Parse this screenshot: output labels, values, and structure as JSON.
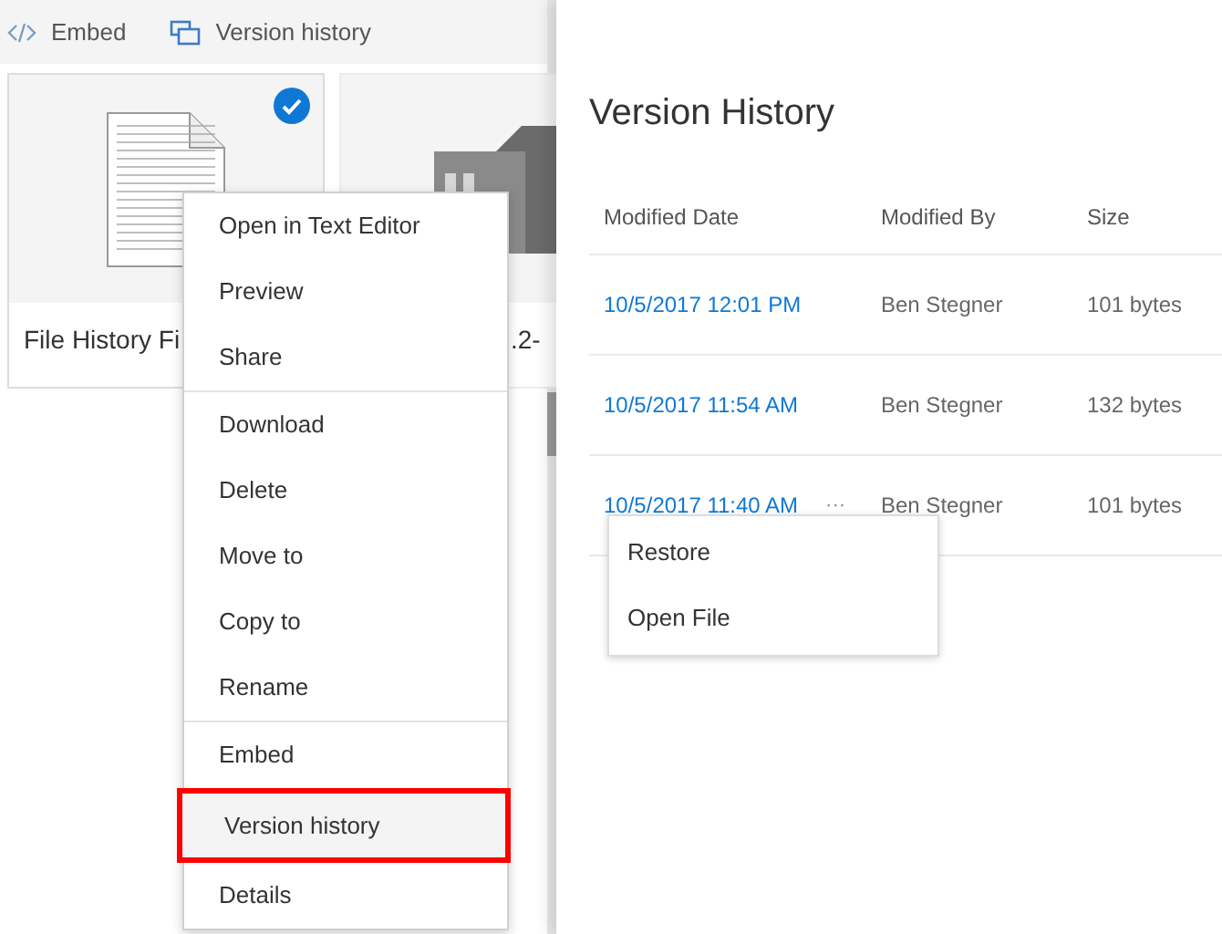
{
  "toolbar": [
    {
      "kind": "embed",
      "label": "Embed"
    },
    {
      "kind": "history",
      "label": "Version history"
    }
  ],
  "tiles": [
    {
      "kind": "text",
      "name": "File History Fi",
      "selected": true
    },
    {
      "kind": "archive",
      "name": ".2-",
      "selected": false
    }
  ],
  "context_menu": {
    "groups": [
      [
        {
          "label": "Open in Text Editor",
          "highlighted": false
        },
        {
          "label": "Preview",
          "highlighted": false
        },
        {
          "label": "Share",
          "highlighted": false
        }
      ],
      [
        {
          "label": "Download",
          "highlighted": false
        },
        {
          "label": "Delete",
          "highlighted": false
        },
        {
          "label": "Move to",
          "highlighted": false
        },
        {
          "label": "Copy to",
          "highlighted": false
        },
        {
          "label": "Rename",
          "highlighted": false
        }
      ],
      [
        {
          "label": "Embed",
          "highlighted": false
        },
        {
          "label": "Version history",
          "highlighted": true
        },
        {
          "label": "Details",
          "highlighted": false
        }
      ]
    ]
  },
  "panel": {
    "title": "Version History",
    "columns": [
      "Modified Date",
      "Modified By",
      "Size"
    ],
    "rows": [
      {
        "date": "10/5/2017 12:01 PM",
        "by": "Ben Stegner",
        "size": "101 bytes"
      },
      {
        "date": "10/5/2017 11:54 AM",
        "by": "Ben Stegner",
        "size": "132 bytes"
      },
      {
        "date": "10/5/2017 11:40 AM",
        "by": "Ben Stegner",
        "size": "101 bytes",
        "more_label": "···"
      }
    ],
    "row_menu": [
      "Restore",
      "Open File"
    ]
  }
}
